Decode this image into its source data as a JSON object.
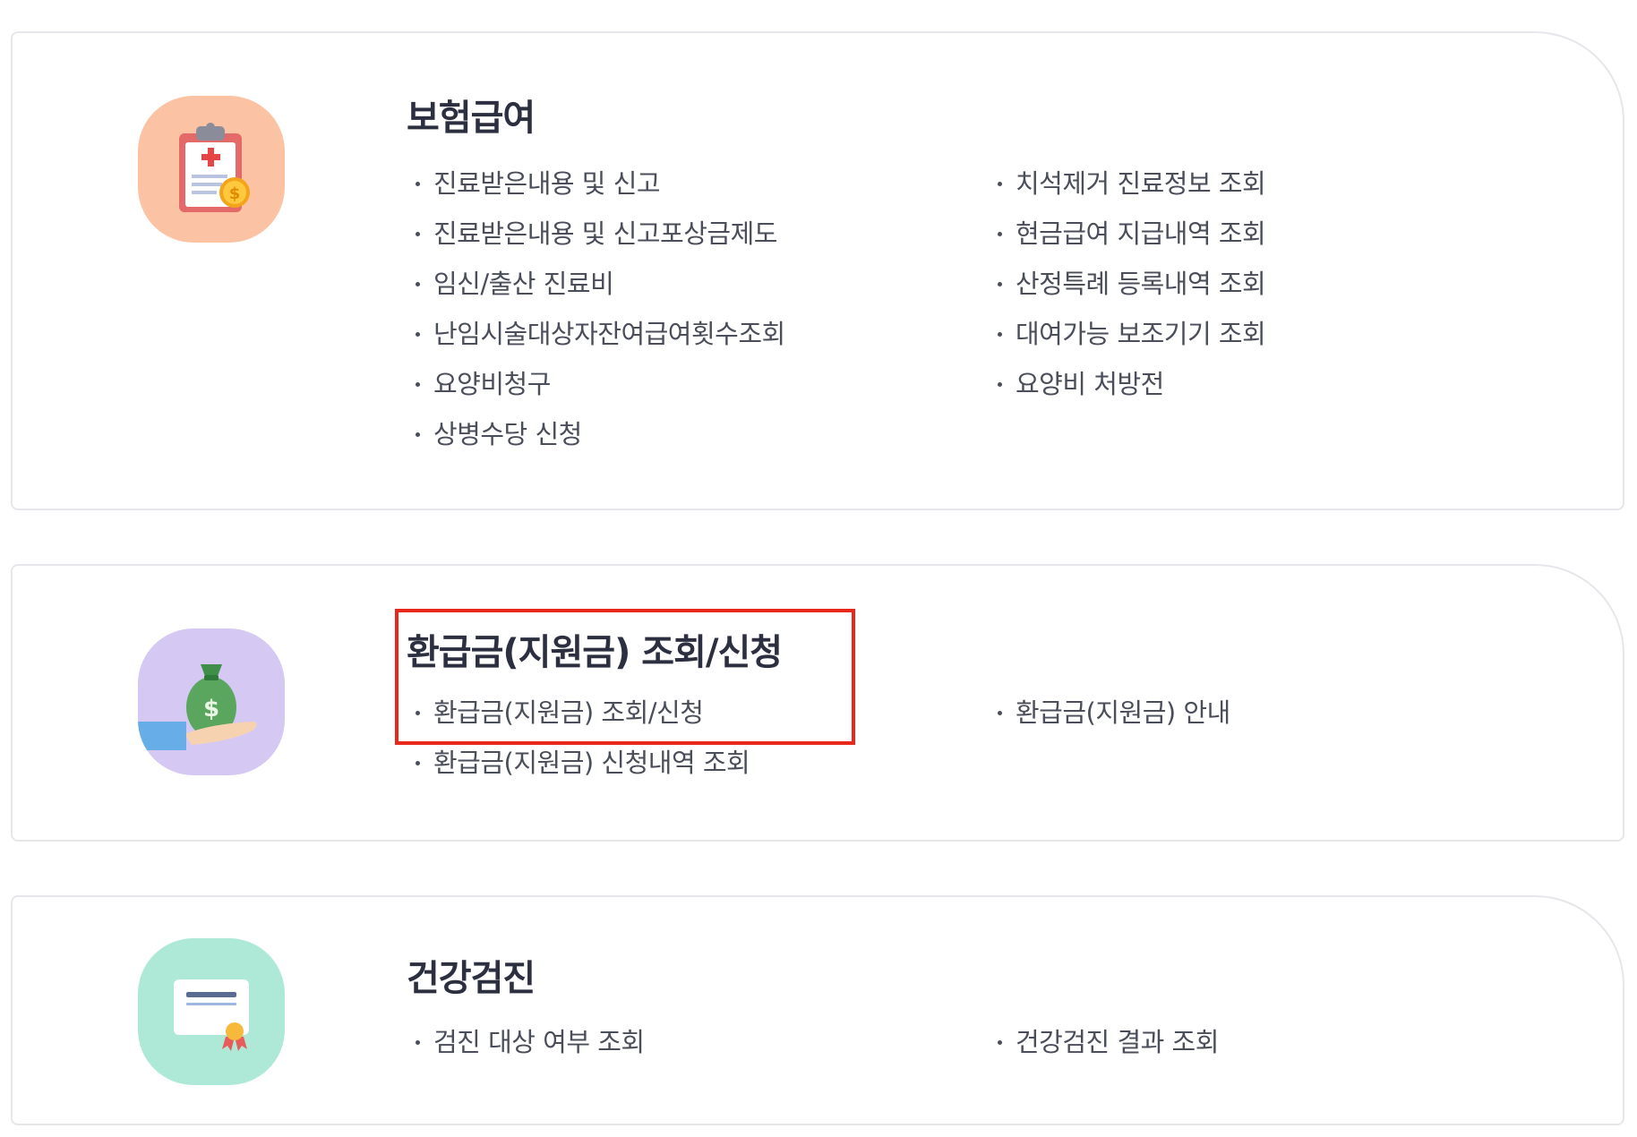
{
  "sections": [
    {
      "title": "보험급여",
      "icon": "clipboard-coin-icon",
      "icon_bg": "#fbc3a4",
      "left_links": [
        "진료받은내용 및 신고",
        "진료받은내용 및 신고포상금제도",
        "임신/출산 진료비",
        "난임시술대상자잔여급여횟수조회",
        "요양비청구",
        "상병수당 신청"
      ],
      "right_links": [
        "치석제거 진료정보 조회",
        "현금급여 지급내역 조회",
        "산정특례 등록내역 조회",
        "대여가능 보조기기 조회",
        "요양비 처방전"
      ]
    },
    {
      "title": "환급금(지원금) 조회/신청",
      "icon": "money-bag-hand-icon",
      "icon_bg": "#d5c9f3",
      "left_links": [
        "환급금(지원금) 조회/신청",
        "환급금(지원금) 신청내역 조회"
      ],
      "right_links": [
        "환급금(지원금) 안내"
      ]
    },
    {
      "title": "건강검진",
      "icon": "certificate-ribbon-icon",
      "icon_bg": "#aee9d8",
      "left_links": [
        "검진 대상 여부 조회"
      ],
      "right_links": [
        "건강검진 결과 조회"
      ]
    }
  ],
  "highlight_color": "#e8281b"
}
